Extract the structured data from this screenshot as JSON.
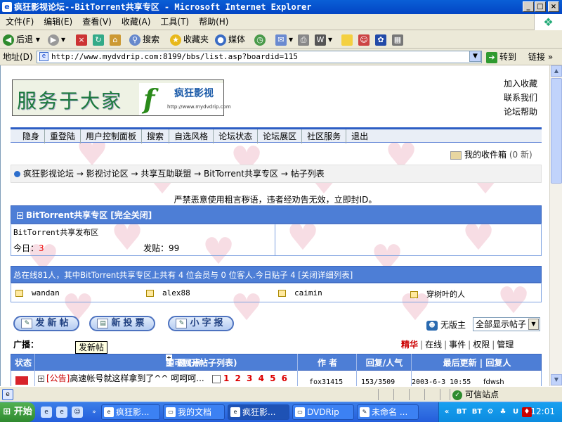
{
  "window": {
    "title": "疯狂影视论坛--BitTorrent共享专区 - Microsoft Internet Explorer",
    "buttons": {
      "minimize": "_",
      "maximize": "□",
      "close": "×"
    }
  },
  "menu": [
    "文件(F)",
    "编辑(E)",
    "查看(V)",
    "收藏(A)",
    "工具(T)",
    "帮助(H)"
  ],
  "toolbar": {
    "back": "后退",
    "search": "搜索",
    "favorites": "收藏夹",
    "media": "媒体"
  },
  "address": {
    "label": "地址(D)",
    "url": "http://www.mydvdrip.com:8199/bbs/list.asp?boardid=115",
    "go": "转到",
    "links": "链接"
  },
  "logo": {
    "text1": "服务于大家",
    "letter": "f",
    "text2": "疯狂影视",
    "url": "http://www.mydvdrip.com"
  },
  "top_links": [
    "加入收藏",
    "联系我们",
    "论坛帮助"
  ],
  "nav": [
    "隐身",
    "重登陆",
    "用户控制面板",
    "搜索",
    "自选风格",
    "论坛状态",
    "论坛展区",
    "社区服务",
    "退出"
  ],
  "inbox": {
    "label": "我的收件箱",
    "count": "(0 新)"
  },
  "breadcrumb": "疯狂影视论坛 → 影视讨论区 → 共享互助联盟 → BitTorrent共享专区 → 帖子列表",
  "warning": "严禁恶意使用粗言秽语，违者经劝告无效，立即封ID。",
  "forum": {
    "header": "BitTorrent共享专区 [完全关闭]",
    "desc": "BitTorrent共享发布区",
    "today_label": "今日：",
    "today_value": "3",
    "posts_label": "发贴：",
    "posts_value": "99"
  },
  "online": {
    "text": "总在线81人，其中BitTorrent共享专区上共有 4 位会员与 0 位客人.今日贴子 4 [关闭详细列表]",
    "users": [
      "wandan",
      "alex88",
      "caimin",
      "穿树叶的人"
    ]
  },
  "actions": {
    "new_post": "发新帖",
    "new_vote": "新投票",
    "notice": "小字报"
  },
  "moderator": "无版主",
  "display_select": "全部显示帖子",
  "broadcast": "广播：",
  "tooltip": "发新帖",
  "filters": [
    "精华",
    "在线",
    "事件",
    "权限",
    "管理"
  ],
  "table": {
    "headers": {
      "status": "状态",
      "subject_a": "主 题 (点",
      "subject_b": "即可展开帖子列表)",
      "author": "作 者",
      "replies": "回复/人气",
      "updated": "最后更新 | 回复人"
    },
    "rows": [
      {
        "tag": "[公告]",
        "title": "高速帐号就这样拿到了^^ 呵呵呵...",
        "pages": "1 2 3 4 5 6",
        "author": "fox31415",
        "replies": "153/3509",
        "updated": "2003-6-3 10:55",
        "last": "fdwsh"
      }
    ]
  },
  "status": {
    "trusted": "可信站点"
  },
  "taskbar": {
    "start": "开始",
    "tasks": [
      "疯狂影...",
      "我的文档",
      "疯狂影...",
      "DVDRip",
      "未命名 ..."
    ],
    "tray_labels": [
      "BT",
      "BT"
    ],
    "time": "12:01"
  }
}
